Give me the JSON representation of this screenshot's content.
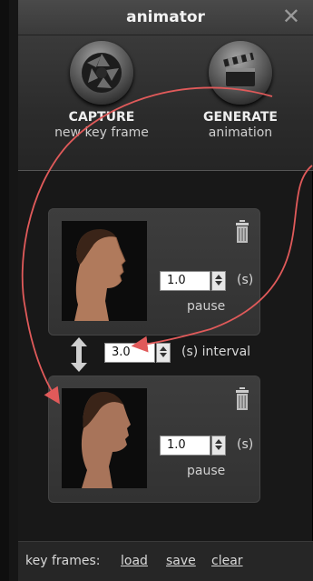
{
  "window": {
    "title": "animator",
    "close_glyph": "✕"
  },
  "toolbar": {
    "capture": {
      "label": "CAPTURE",
      "sublabel": "new key frame",
      "icon": "camera-aperture-icon"
    },
    "generate": {
      "label": "GENERATE",
      "sublabel": "animation",
      "icon": "clapperboard-icon"
    }
  },
  "keyframes": [
    {
      "pause_value": "1.0",
      "unit": "(s)",
      "pause_label": "pause",
      "icon": "trash-icon"
    },
    {
      "pause_value": "1.0",
      "unit": "(s)",
      "pause_label": "pause",
      "icon": "trash-icon"
    }
  ],
  "interval": {
    "value": "3.0",
    "label": "(s) interval",
    "icon": "vertical-resize-arrow-icon"
  },
  "footer": {
    "lead": "key frames:",
    "load": "load",
    "save": "save",
    "clear": "clear"
  },
  "colors": {
    "annotation_arrow": "#e05a5a"
  }
}
